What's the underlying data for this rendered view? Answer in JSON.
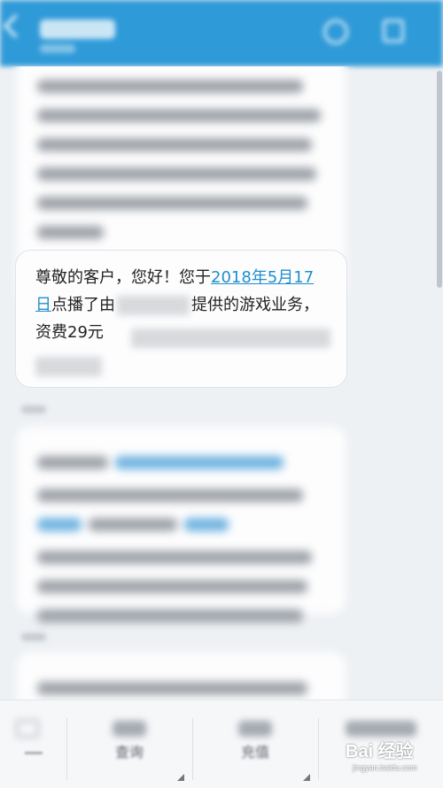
{
  "theme": {
    "header_color": "#2f9ad8",
    "link_color": "#1f8ecf",
    "background": "#eef1f4"
  },
  "header": {
    "back_icon": "back-arrow-icon",
    "call_icon": "phone-icon",
    "more_icon": "contact-icon"
  },
  "messages": {
    "visible": {
      "part1": "尊敬的客户，您好！您于",
      "date_link": "2018年5月17日",
      "part2": "点播了由",
      "part3": "提供的游戏业务，资费29元"
    }
  },
  "bottom_bar": {
    "keyboard_icon": "keyboard-icon",
    "tabs": [
      {
        "label": "查询"
      },
      {
        "label": "充值"
      },
      {
        "label": ""
      }
    ]
  },
  "watermark": {
    "logo": "Bai 经验",
    "url": "jingyan.baidu.com"
  }
}
